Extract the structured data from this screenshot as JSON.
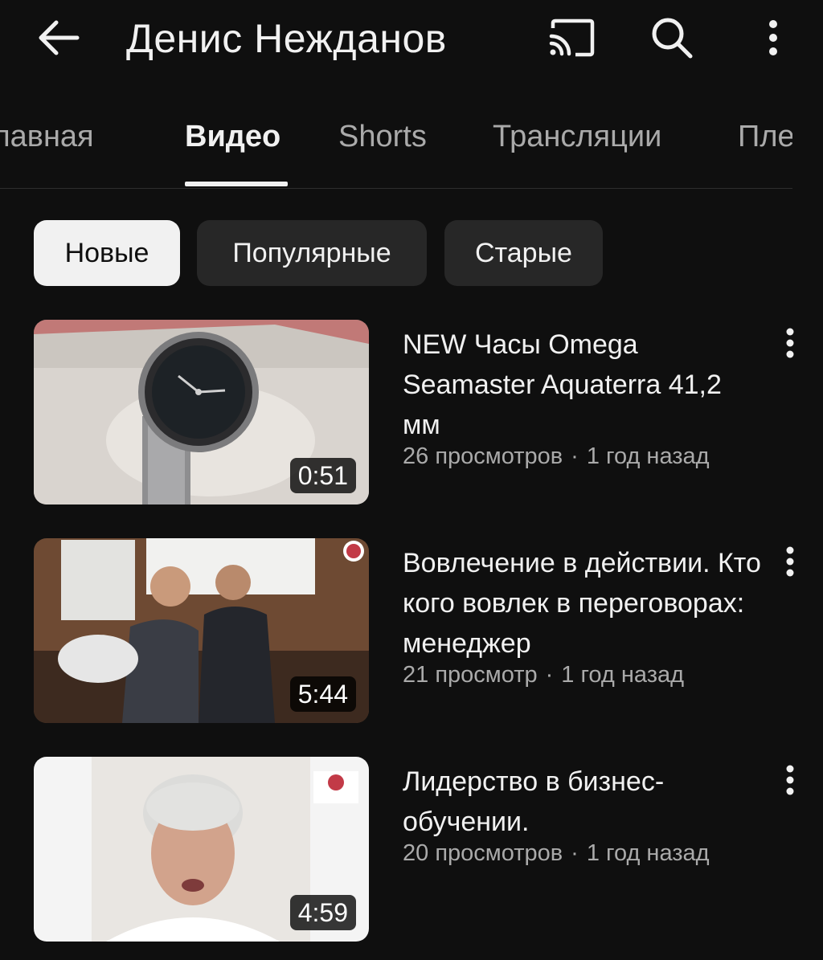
{
  "header": {
    "channel_name": "Денис Нежданов",
    "icons": {
      "back": "arrow-back-icon",
      "cast": "cast-icon",
      "search": "search-icon",
      "more": "more-vertical-icon"
    }
  },
  "tabs": [
    {
      "label": "Главная",
      "active": false
    },
    {
      "label": "Видео",
      "active": true
    },
    {
      "label": "Shorts",
      "active": false
    },
    {
      "label": "Трансляции",
      "active": false
    },
    {
      "label": "Плейлисты",
      "active": false
    }
  ],
  "filters": [
    {
      "label": "Новые",
      "selected": true
    },
    {
      "label": "Популярные",
      "selected": false
    },
    {
      "label": "Старые",
      "selected": false
    }
  ],
  "videos": [
    {
      "title": "NEW Часы Omega Seamaster Aquaterra 41,2 мм",
      "views": "26 просмотров",
      "age": "1 год назад",
      "duration": "0:51"
    },
    {
      "title": "Вовлечение в действии. Кто кого вовлек в переговорах: менеджер",
      "views": "21 просмотр",
      "age": "1 год назад",
      "duration": "5:44"
    },
    {
      "title": "Лидерство в бизнес-обучении.",
      "views": "20 просмотров",
      "age": "1 год назад",
      "duration": "4:59"
    }
  ],
  "colors": {
    "background": "#0f0f0f",
    "text_primary": "#f1f1f1",
    "text_secondary": "#aaaaaa",
    "chip_selected_bg": "#f1f1f1",
    "chip_bg": "#272727"
  }
}
